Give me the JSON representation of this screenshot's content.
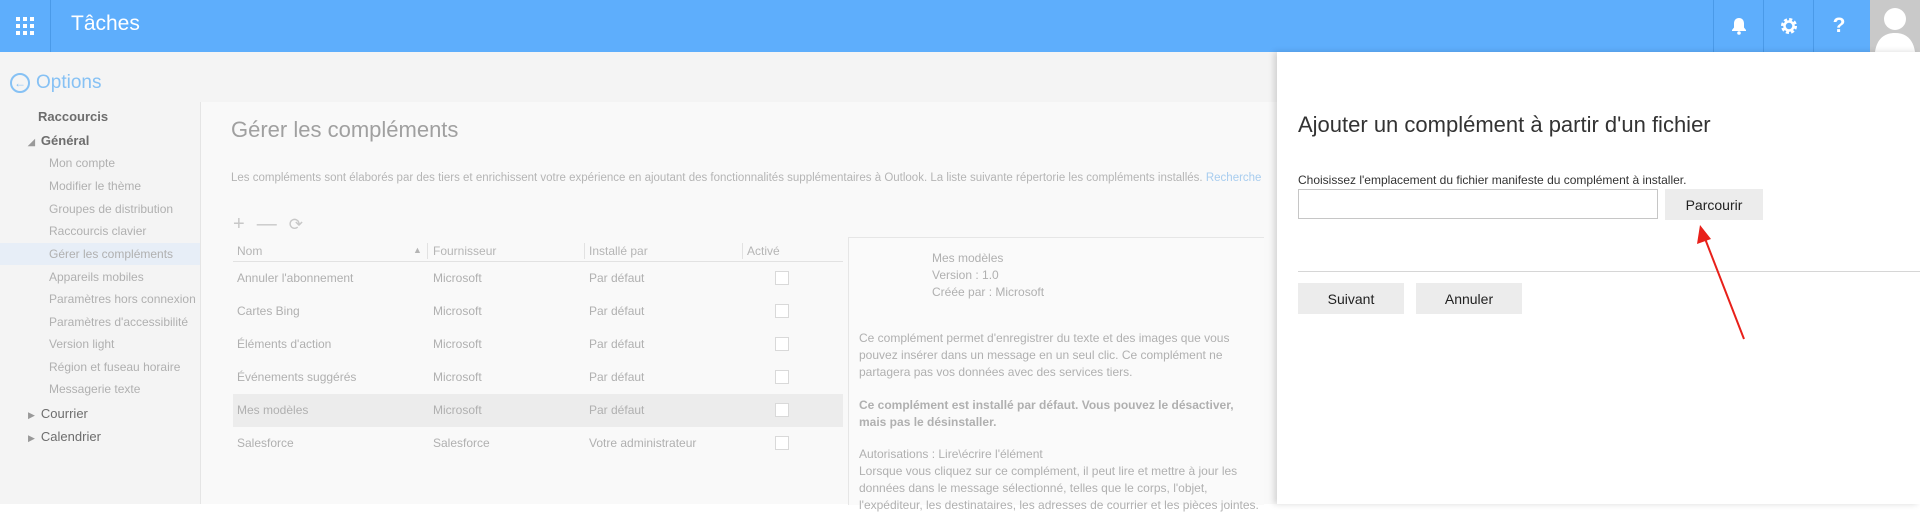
{
  "app": {
    "title": "Tâches",
    "icons": [
      "waffle-icon",
      "bell-icon",
      "gear-icon",
      "help-icon",
      "avatar"
    ]
  },
  "options": {
    "back_label": "Options",
    "nav": {
      "shortcuts": "Raccourcis",
      "general": "Général",
      "general_items": [
        "Mon compte",
        "Modifier le thème",
        "Groupes de distribution",
        "Raccourcis clavier",
        "Gérer les compléments",
        "Appareils mobiles",
        "Paramètres hors connexion",
        "Paramètres d'accessibilité",
        "Version light",
        "Région et fuseau horaire",
        "Messagerie texte"
      ],
      "mail": "Courrier",
      "calendar": "Calendrier"
    }
  },
  "main": {
    "title": "Gérer les compléments",
    "intro": "Les compléments sont élaborés par des tiers et enrichissent votre expérience en ajoutant des fonctionnalités supplémentaires à Outlook. La liste suivante répertorie les compléments installés.",
    "intro_link": "Recherche",
    "toolbar": {
      "add": "+",
      "remove": "—",
      "refresh": "⟳"
    },
    "table": {
      "headers": [
        "Nom",
        "Fournisseur",
        "Installé par",
        "Activé"
      ],
      "rows": [
        [
          "Annuler l'abonnement",
          "Microsoft",
          "Par défaut"
        ],
        [
          "Cartes Bing",
          "Microsoft",
          "Par défaut"
        ],
        [
          "Éléments d'action",
          "Microsoft",
          "Par défaut"
        ],
        [
          "Événements suggérés",
          "Microsoft",
          "Par défaut"
        ],
        [
          "Mes modèles",
          "Microsoft",
          "Par défaut"
        ],
        [
          "Salesforce",
          "Salesforce",
          "Votre administrateur"
        ]
      ]
    },
    "detail": {
      "name": "Mes modèles",
      "version": "Version : 1.0",
      "created_by": "Créée par : Microsoft",
      "description": "Ce complément permet d'enregistrer du texte et des images que vous pouvez insérer dans un message en un seul clic. Ce complément ne partagera pas vos données avec des services tiers.",
      "default_note": "Ce complément est installé par défaut. Vous pouvez le désactiver, mais pas le désinstaller.",
      "permissions": "Autorisations : Lire\\écrire l'élément",
      "permissions_text": "Lorsque vous cliquez sur ce complément, il peut lire et mettre à jour les données dans le message sélectionné, telles que le corps, l'objet, l'expéditeur, les destinataires, les adresses de courrier et les pièces jointes."
    }
  },
  "flyout": {
    "title": "Ajouter un complément à partir d'un fichier",
    "label": "Choisissez l'emplacement du fichier manifeste du complément à installer.",
    "file_value": "",
    "browse": "Parcourir",
    "next": "Suivant",
    "cancel": "Annuler"
  },
  "colors": {
    "topbar": "#5eaefc",
    "annotation_arrow": "#e8201a"
  }
}
